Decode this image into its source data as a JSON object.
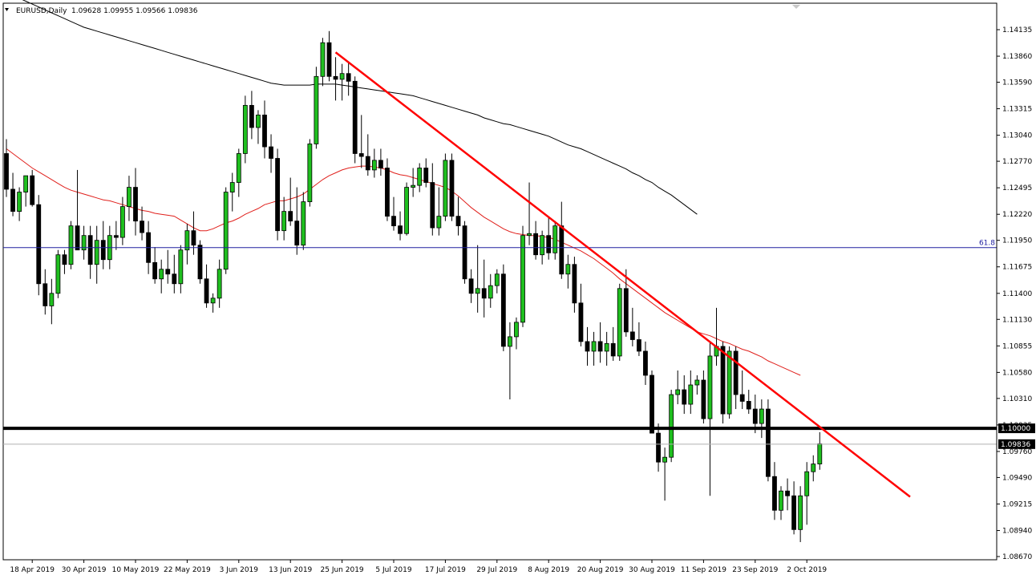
{
  "header": {
    "symbol": "EURUSD,Daily",
    "ohlc": "1.09628 1.09955 1.09566 1.09836"
  },
  "colors": {
    "background": "#ffffff",
    "bull_body": "#1fbf1f",
    "bear_body": "#000000",
    "wick": "#000000",
    "ma_short": "#e0201c",
    "ma_long": "#000000",
    "trendline": "#ff0000",
    "fib_line": "#2020a0",
    "support_line": "#000000"
  },
  "chart_data": {
    "type": "candlestick",
    "title": "EURUSD,Daily",
    "y_ticks": [
      "1.14135",
      "1.13860",
      "1.13590",
      "1.13315",
      "1.13040",
      "1.12770",
      "1.12495",
      "1.12220",
      "1.11950",
      "1.11675",
      "1.11400",
      "1.11130",
      "1.10855",
      "1.10580",
      "1.10310",
      "1.10035",
      "1.09760",
      "1.09490",
      "1.09215",
      "1.08940",
      "1.08670"
    ],
    "ylim": [
      1.0867,
      1.1441
    ],
    "x_ticks": [
      "18 Apr 2019",
      "30 Apr 2019",
      "10 May 2019",
      "22 May 2019",
      "3 Jun 2019",
      "13 Jun 2019",
      "25 Jun 2019",
      "5 Jul 2019",
      "17 Jul 2019",
      "29 Jul 2019",
      "8 Aug 2019",
      "20 Aug 2019",
      "30 Aug 2019",
      "11 Sep 2019",
      "23 Sep 2019",
      "2 Oct 2019"
    ],
    "x_tick_bar_index": [
      4,
      12,
      20,
      28,
      36,
      44,
      52,
      60,
      68,
      76,
      84,
      92,
      100,
      108,
      116,
      124
    ],
    "candles": [
      [
        1.1285,
        1.13,
        1.124,
        1.1248
      ],
      [
        1.1248,
        1.1265,
        1.122,
        1.1225
      ],
      [
        1.1225,
        1.125,
        1.1215,
        1.1245
      ],
      [
        1.1245,
        1.1262,
        1.123,
        1.1262
      ],
      [
        1.1262,
        1.1268,
        1.123,
        1.1232
      ],
      [
        1.1232,
        1.1242,
        1.1138,
        1.115
      ],
      [
        1.115,
        1.1165,
        1.1118,
        1.1127
      ],
      [
        1.1127,
        1.1155,
        1.1108,
        1.114
      ],
      [
        1.114,
        1.1185,
        1.1135,
        1.118
      ],
      [
        1.118,
        1.1185,
        1.116,
        1.117
      ],
      [
        1.117,
        1.1215,
        1.1165,
        1.121
      ],
      [
        1.121,
        1.1268,
        1.119,
        1.1185
      ],
      [
        1.1185,
        1.121,
        1.1175,
        1.12
      ],
      [
        1.12,
        1.121,
        1.1155,
        1.117
      ],
      [
        1.117,
        1.121,
        1.115,
        1.1195
      ],
      [
        1.1195,
        1.1215,
        1.1165,
        1.1175
      ],
      [
        1.1175,
        1.121,
        1.1165,
        1.12
      ],
      [
        1.12,
        1.1215,
        1.1185,
        1.1198
      ],
      [
        1.1198,
        1.124,
        1.119,
        1.123
      ],
      [
        1.123,
        1.1262,
        1.1215,
        1.125
      ],
      [
        1.125,
        1.127,
        1.12,
        1.1215
      ],
      [
        1.1215,
        1.123,
        1.1195,
        1.1203
      ],
      [
        1.1203,
        1.1215,
        1.116,
        1.1172
      ],
      [
        1.1172,
        1.1188,
        1.115,
        1.1155
      ],
      [
        1.1155,
        1.1175,
        1.114,
        1.1165
      ],
      [
        1.1165,
        1.1185,
        1.115,
        1.116
      ],
      [
        1.116,
        1.118,
        1.114,
        1.115
      ],
      [
        1.115,
        1.119,
        1.114,
        1.1185
      ],
      [
        1.1185,
        1.1212,
        1.117,
        1.1205
      ],
      [
        1.1205,
        1.1225,
        1.118,
        1.119
      ],
      [
        1.119,
        1.1195,
        1.115,
        1.1155
      ],
      [
        1.1155,
        1.117,
        1.1125,
        1.113
      ],
      [
        1.113,
        1.114,
        1.112,
        1.1135
      ],
      [
        1.1135,
        1.1175,
        1.1125,
        1.1165
      ],
      [
        1.1165,
        1.125,
        1.116,
        1.1245
      ],
      [
        1.1245,
        1.1265,
        1.1225,
        1.1255
      ],
      [
        1.1255,
        1.129,
        1.124,
        1.1285
      ],
      [
        1.1285,
        1.1345,
        1.1275,
        1.1335
      ],
      [
        1.1335,
        1.135,
        1.13,
        1.1312
      ],
      [
        1.1312,
        1.133,
        1.1295,
        1.1325
      ],
      [
        1.1325,
        1.134,
        1.128,
        1.1292
      ],
      [
        1.1292,
        1.1305,
        1.1265,
        1.128
      ],
      [
        1.128,
        1.129,
        1.1195,
        1.1205
      ],
      [
        1.1205,
        1.124,
        1.1195,
        1.1225
      ],
      [
        1.1225,
        1.126,
        1.121,
        1.1215
      ],
      [
        1.1215,
        1.125,
        1.118,
        1.119
      ],
      [
        1.119,
        1.1245,
        1.1185,
        1.1235
      ],
      [
        1.1235,
        1.13,
        1.123,
        1.1295
      ],
      [
        1.1295,
        1.1375,
        1.129,
        1.1365
      ],
      [
        1.1365,
        1.1405,
        1.1355,
        1.14
      ],
      [
        1.14,
        1.1412,
        1.136,
        1.1365
      ],
      [
        1.1365,
        1.1385,
        1.134,
        1.1362
      ],
      [
        1.1362,
        1.1378,
        1.134,
        1.1368
      ],
      [
        1.1368,
        1.138,
        1.1345,
        1.136
      ],
      [
        1.136,
        1.1365,
        1.1275,
        1.1285
      ],
      [
        1.1285,
        1.1325,
        1.127,
        1.1282
      ],
      [
        1.1282,
        1.1305,
        1.1262,
        1.1268
      ],
      [
        1.1268,
        1.129,
        1.126,
        1.1278
      ],
      [
        1.1278,
        1.129,
        1.1262,
        1.127
      ],
      [
        1.127,
        1.128,
        1.1215,
        1.122
      ],
      [
        1.122,
        1.124,
        1.1205,
        1.121
      ],
      [
        1.121,
        1.1225,
        1.1195,
        1.1202
      ],
      [
        1.1202,
        1.1255,
        1.12,
        1.125
      ],
      [
        1.125,
        1.127,
        1.124,
        1.1252
      ],
      [
        1.1252,
        1.1275,
        1.1245,
        1.127
      ],
      [
        1.127,
        1.128,
        1.125,
        1.1255
      ],
      [
        1.1255,
        1.1275,
        1.12,
        1.1208
      ],
      [
        1.1208,
        1.125,
        1.12,
        1.122
      ],
      [
        1.122,
        1.1285,
        1.1215,
        1.1278
      ],
      [
        1.1278,
        1.1285,
        1.1215,
        1.122
      ],
      [
        1.122,
        1.124,
        1.12,
        1.121
      ],
      [
        1.121,
        1.1215,
        1.115,
        1.1155
      ],
      [
        1.1155,
        1.1165,
        1.113,
        1.114
      ],
      [
        1.114,
        1.119,
        1.112,
        1.1145
      ],
      [
        1.1145,
        1.1175,
        1.1115,
        1.1135
      ],
      [
        1.1135,
        1.116,
        1.1125,
        1.1148
      ],
      [
        1.1148,
        1.1165,
        1.114,
        1.116
      ],
      [
        1.116,
        1.117,
        1.108,
        1.1085
      ],
      [
        1.1085,
        1.111,
        1.103,
        1.1095
      ],
      [
        1.1095,
        1.1115,
        1.1082,
        1.111
      ],
      [
        1.111,
        1.121,
        1.1105,
        1.12
      ],
      [
        1.12,
        1.1255,
        1.119,
        1.1202
      ],
      [
        1.1202,
        1.1215,
        1.1175,
        1.118
      ],
      [
        1.118,
        1.1205,
        1.117,
        1.12
      ],
      [
        1.12,
        1.122,
        1.1175,
        1.1182
      ],
      [
        1.1182,
        1.1215,
        1.1175,
        1.121
      ],
      [
        1.121,
        1.1235,
        1.1155,
        1.116
      ],
      [
        1.116,
        1.118,
        1.1145,
        1.117
      ],
      [
        1.117,
        1.1178,
        1.112,
        1.113
      ],
      [
        1.113,
        1.115,
        1.1085,
        1.109
      ],
      [
        1.109,
        1.1105,
        1.1065,
        1.108
      ],
      [
        1.108,
        1.11,
        1.1065,
        1.109
      ],
      [
        1.109,
        1.111,
        1.1068,
        1.108
      ],
      [
        1.108,
        1.11,
        1.1065,
        1.1088
      ],
      [
        1.1088,
        1.1105,
        1.107,
        1.1075
      ],
      [
        1.1075,
        1.115,
        1.107,
        1.1145
      ],
      [
        1.1145,
        1.1165,
        1.1095,
        1.11
      ],
      [
        1.11,
        1.1125,
        1.1085,
        1.1092
      ],
      [
        1.1092,
        1.111,
        1.1075,
        1.108
      ],
      [
        1.108,
        1.109,
        1.1045,
        1.1055
      ],
      [
        1.1055,
        1.106,
        1.1,
        1.0995
      ],
      [
        1.0995,
        1.1005,
        1.0955,
        1.0965
      ],
      [
        1.0965,
        1.098,
        1.0925,
        1.097
      ],
      [
        1.097,
        1.104,
        1.0965,
        1.1035
      ],
      [
        1.1035,
        1.106,
        1.1025,
        1.104
      ],
      [
        1.104,
        1.1055,
        1.1015,
        1.1025
      ],
      [
        1.1025,
        1.106,
        1.1015,
        1.1045
      ],
      [
        1.1045,
        1.1055,
        1.1035,
        1.105
      ],
      [
        1.105,
        1.106,
        1.1005,
        1.101
      ],
      [
        1.101,
        1.109,
        1.093,
        1.1075
      ],
      [
        1.1075,
        1.1125,
        1.1065,
        1.1085
      ],
      [
        1.1085,
        1.109,
        1.1005,
        1.1015
      ],
      [
        1.1015,
        1.1085,
        1.101,
        1.108
      ],
      [
        1.108,
        1.1085,
        1.102,
        1.1035
      ],
      [
        1.1035,
        1.106,
        1.102,
        1.1028
      ],
      [
        1.1028,
        1.104,
        1.1015,
        1.102
      ],
      [
        1.102,
        1.1035,
        1.0995,
        1.1005
      ],
      [
        1.1005,
        1.103,
        1.099,
        1.102
      ],
      [
        1.102,
        1.103,
        1.0945,
        1.095
      ],
      [
        1.095,
        1.0965,
        1.0905,
        1.0915
      ],
      [
        1.0915,
        1.094,
        1.0905,
        1.0935
      ],
      [
        1.0935,
        1.0948,
        1.0915,
        1.093
      ],
      [
        1.093,
        1.0945,
        1.089,
        1.0895
      ],
      [
        1.0895,
        1.094,
        1.0882,
        1.093
      ],
      [
        1.093,
        1.0965,
        1.09,
        1.0955
      ],
      [
        1.0955,
        1.0972,
        1.0945,
        1.0963
      ],
      [
        1.0963,
        1.0996,
        1.0957,
        1.0984
      ]
    ],
    "ma_short": {
      "name": "",
      "values": [
        1.129,
        1.1285,
        1.128,
        1.1275,
        1.127,
        1.1266,
        1.1262,
        1.1258,
        1.1254,
        1.125,
        1.1247,
        1.1245,
        1.1243,
        1.1241,
        1.1239,
        1.1237,
        1.1236,
        1.1234,
        1.1232,
        1.123,
        1.1228,
        1.1226,
        1.1225,
        1.1223,
        1.1222,
        1.1221,
        1.122,
        1.1216,
        1.1212,
        1.1208,
        1.1205,
        1.1205,
        1.1207,
        1.121,
        1.1213,
        1.1215,
        1.1218,
        1.1222,
        1.1225,
        1.1228,
        1.1232,
        1.1234,
        1.1236,
        1.1236,
        1.1238,
        1.124,
        1.1243,
        1.1248,
        1.1253,
        1.1258,
        1.1262,
        1.1265,
        1.1268,
        1.127,
        1.1271,
        1.1272,
        1.1272,
        1.1271,
        1.127,
        1.1268,
        1.1265,
        1.1263,
        1.1262,
        1.126,
        1.1258,
        1.1256,
        1.1254,
        1.1252,
        1.125,
        1.1246,
        1.1241,
        1.1235,
        1.1229,
        1.1224,
        1.1219,
        1.1215,
        1.1211,
        1.1207,
        1.1204,
        1.1202,
        1.1201,
        1.12,
        1.12,
        1.1199,
        1.1198,
        1.1196,
        1.1193,
        1.119,
        1.1187,
        1.1184,
        1.118,
        1.1176,
        1.1171,
        1.1166,
        1.1161,
        1.1155,
        1.115,
        1.1145,
        1.114,
        1.1135,
        1.113,
        1.1125,
        1.112,
        1.1116,
        1.1112,
        1.1108,
        1.1104,
        1.11,
        1.1098,
        1.1096,
        1.1093,
        1.109,
        1.1088,
        1.1085,
        1.1082,
        1.108,
        1.1077,
        1.1074,
        1.107,
        1.1067,
        1.1064,
        1.1061,
        1.1058,
        1.1055
      ]
    },
    "ma_long": {
      "name": "",
      "values": [
        1.1452,
        1.1449,
        1.1446,
        1.1443,
        1.144,
        1.1437,
        1.1434,
        1.1431,
        1.1428,
        1.1425,
        1.1422,
        1.1419,
        1.1416,
        1.1414,
        1.1412,
        1.141,
        1.1408,
        1.1406,
        1.1404,
        1.1402,
        1.14,
        1.1398,
        1.1396,
        1.1394,
        1.1392,
        1.139,
        1.1388,
        1.1386,
        1.1384,
        1.1382,
        1.138,
        1.1378,
        1.1376,
        1.1374,
        1.1372,
        1.137,
        1.1368,
        1.1366,
        1.1364,
        1.1362,
        1.136,
        1.1358,
        1.1357,
        1.1356,
        1.1356,
        1.1356,
        1.1356,
        1.1356,
        1.1357,
        1.1357,
        1.1357,
        1.1357,
        1.1356,
        1.1355,
        1.1354,
        1.1353,
        1.1352,
        1.1351,
        1.135,
        1.1349,
        1.1348,
        1.1347,
        1.1346,
        1.1345,
        1.1343,
        1.1341,
        1.1339,
        1.1337,
        1.1335,
        1.1333,
        1.1331,
        1.1329,
        1.1327,
        1.1325,
        1.1322,
        1.132,
        1.1318,
        1.1316,
        1.1315,
        1.1313,
        1.1311,
        1.1309,
        1.1307,
        1.1305,
        1.1303,
        1.13,
        1.1297,
        1.1294,
        1.1292,
        1.129,
        1.1287,
        1.1284,
        1.1281,
        1.1278,
        1.1275,
        1.1272,
        1.1269,
        1.1265,
        1.1262,
        1.1258,
        1.1255,
        1.125,
        1.1246,
        1.1242,
        1.1237,
        1.1232,
        1.1227,
        1.1222
      ]
    },
    "trendline": {
      "start_bar": 51,
      "start_price": 1.139,
      "end_bar": 140,
      "end_price": 1.0929
    },
    "fib_level": {
      "price": 1.11875,
      "label": "61.8"
    },
    "support_level": {
      "price": 1.1,
      "label": "1.10000"
    },
    "current_price": {
      "price": 1.09836,
      "label": "1.09836"
    },
    "grid": false
  }
}
